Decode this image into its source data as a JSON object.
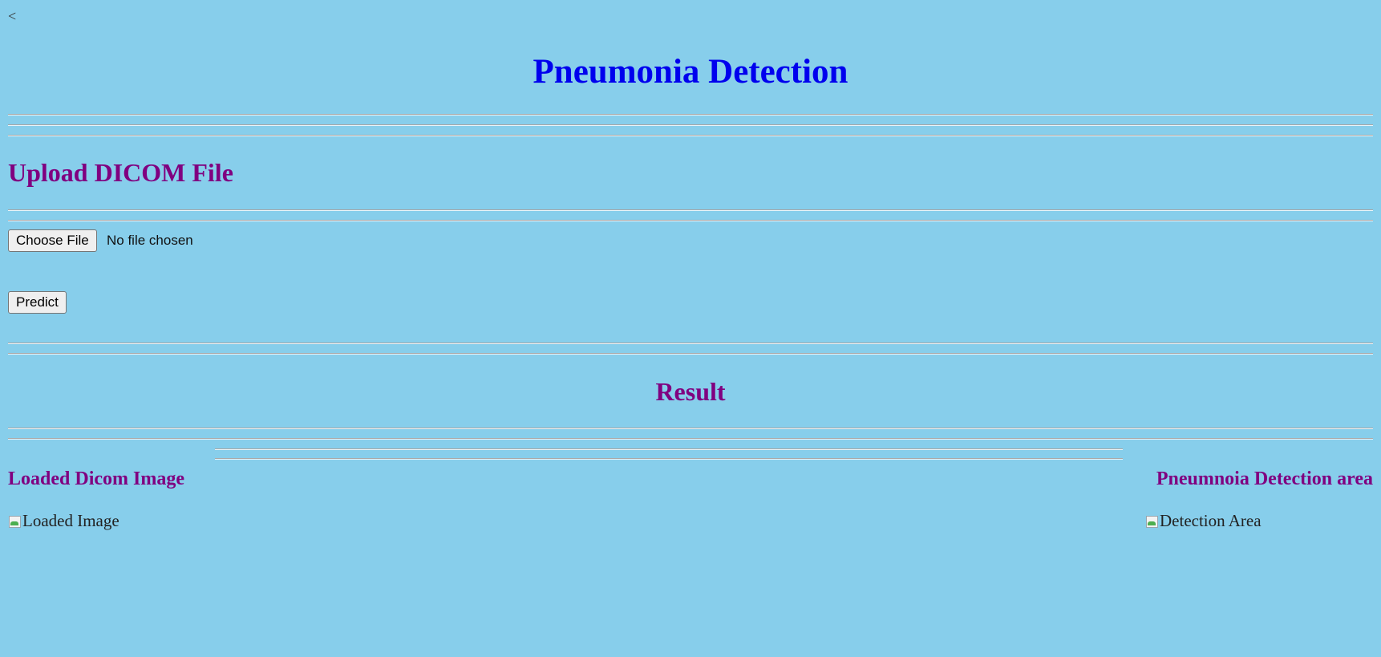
{
  "nav": {
    "back_label": "<"
  },
  "header": {
    "title": "Pneumonia Detection"
  },
  "upload": {
    "heading": "Upload DICOM File",
    "choose_file_label": "Choose File",
    "file_status": "No file chosen",
    "predict_label": "Predict"
  },
  "result": {
    "heading": "Result",
    "loaded": {
      "heading": "Loaded Dicom Image",
      "alt": "Loaded Image",
      "icon": "broken-image-icon"
    },
    "detection": {
      "heading": "Pneumnoia Detection area",
      "alt": "Detection Area",
      "icon": "broken-image-icon"
    }
  },
  "colors": {
    "background": "#87ceeb",
    "title": "#0000ee",
    "heading": "#800080",
    "rule": "#a7a7a7"
  }
}
